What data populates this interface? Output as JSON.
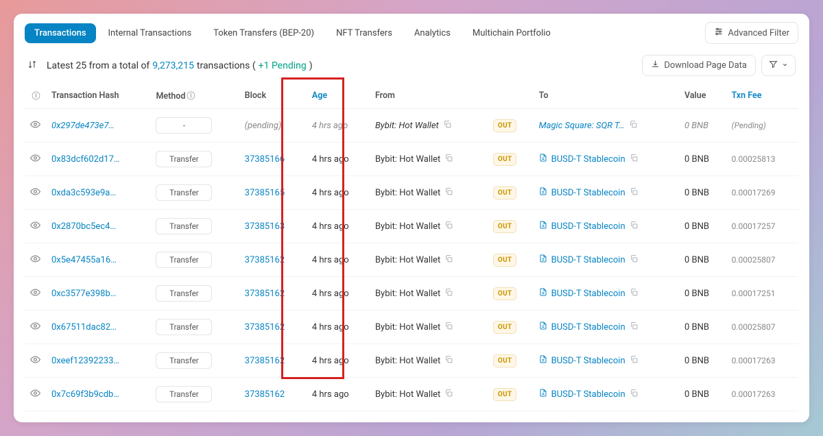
{
  "tabs": {
    "active": "Transactions",
    "items": [
      "Transactions",
      "Internal Transactions",
      "Token Transfers (BEP-20)",
      "NFT Transfers",
      "Analytics",
      "Multichain Portfolio"
    ],
    "advanced_filter": "Advanced Filter"
  },
  "meta": {
    "prefix": "Latest 25 from a total of ",
    "total": "9,273,215",
    "after_total": " transactions (",
    "pending": "+1 Pending",
    "after_pending": ")",
    "download": "Download Page Data"
  },
  "headers": {
    "eye": "",
    "hash": "Transaction Hash",
    "method": "Method",
    "block": "Block",
    "age": "Age",
    "from": "From",
    "dir": "",
    "to": "To",
    "value": "Value",
    "fee": "Txn Fee"
  },
  "rows": [
    {
      "hash": "0x297de473e7…",
      "hash_italic": true,
      "method": "-",
      "method_blank": true,
      "block": "(pending)",
      "block_pending": true,
      "age": "4 hrs ago",
      "age_italic": true,
      "from": "Bybit: Hot Wallet",
      "from_italic": true,
      "dir": "OUT",
      "to": "Magic Square: SQR T…",
      "to_italic": true,
      "to_doc": false,
      "value": "0 BNB",
      "value_italic": true,
      "fee": "(Pending)",
      "fee_pending": true
    },
    {
      "hash": "0x83dcf602d17…",
      "method": "Transfer",
      "block": "37385166",
      "age": "4 hrs ago",
      "from": "Bybit: Hot Wallet",
      "dir": "OUT",
      "to": "BUSD-T Stablecoin",
      "to_doc": true,
      "value": "0 BNB",
      "fee": "0.00025813"
    },
    {
      "hash": "0xda3c593e9a…",
      "method": "Transfer",
      "block": "37385165",
      "age": "4 hrs ago",
      "from": "Bybit: Hot Wallet",
      "dir": "OUT",
      "to": "BUSD-T Stablecoin",
      "to_doc": true,
      "value": "0 BNB",
      "fee": "0.00017269"
    },
    {
      "hash": "0x2870bc5ec4…",
      "method": "Transfer",
      "block": "37385163",
      "age": "4 hrs ago",
      "from": "Bybit: Hot Wallet",
      "dir": "OUT",
      "to": "BUSD-T Stablecoin",
      "to_doc": true,
      "value": "0 BNB",
      "fee": "0.00017257"
    },
    {
      "hash": "0x5e47455a16…",
      "method": "Transfer",
      "block": "37385162",
      "age": "4 hrs ago",
      "from": "Bybit: Hot Wallet",
      "dir": "OUT",
      "to": "BUSD-T Stablecoin",
      "to_doc": true,
      "value": "0 BNB",
      "fee": "0.00025807"
    },
    {
      "hash": "0xc3577e398b…",
      "method": "Transfer",
      "block": "37385162",
      "age": "4 hrs ago",
      "from": "Bybit: Hot Wallet",
      "dir": "OUT",
      "to": "BUSD-T Stablecoin",
      "to_doc": true,
      "value": "0 BNB",
      "fee": "0.00017251"
    },
    {
      "hash": "0x67511dac82…",
      "method": "Transfer",
      "block": "37385162",
      "age": "4 hrs ago",
      "from": "Bybit: Hot Wallet",
      "dir": "OUT",
      "to": "BUSD-T Stablecoin",
      "to_doc": true,
      "value": "0 BNB",
      "fee": "0.00025807"
    },
    {
      "hash": "0xeef12392233…",
      "method": "Transfer",
      "block": "37385162",
      "age": "4 hrs ago",
      "from": "Bybit: Hot Wallet",
      "dir": "OUT",
      "to": "BUSD-T Stablecoin",
      "to_doc": true,
      "value": "0 BNB",
      "fee": "0.00017263"
    },
    {
      "hash": "0x7c69f3b9cdb…",
      "method": "Transfer",
      "block": "37385162",
      "age": "4 hrs ago",
      "from": "Bybit: Hot Wallet",
      "dir": "OUT",
      "to": "BUSD-T Stablecoin",
      "to_doc": true,
      "value": "0 BNB",
      "fee": "0.00017263"
    }
  ]
}
